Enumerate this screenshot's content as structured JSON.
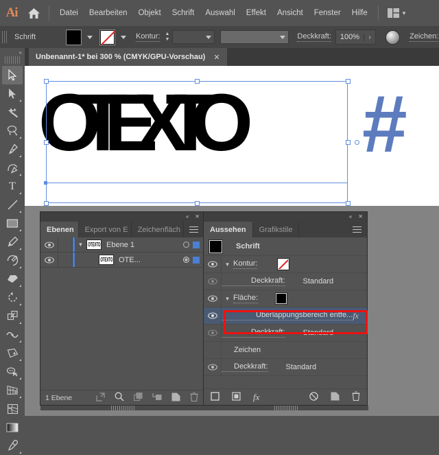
{
  "app": {
    "logo": "Ai",
    "home_icon": "home-icon"
  },
  "menu": {
    "items": [
      {
        "label": "Datei"
      },
      {
        "label": "Bearbeiten"
      },
      {
        "label": "Objekt"
      },
      {
        "label": "Schrift"
      },
      {
        "label": "Auswahl"
      },
      {
        "label": "Effekt"
      },
      {
        "label": "Ansicht"
      },
      {
        "label": "Fenster"
      },
      {
        "label": "Hilfe"
      }
    ],
    "workspace_icon": "workspace-switcher-icon",
    "workspace_chevron": "ⱟ"
  },
  "control_bar": {
    "context_label": "Schrift",
    "fill_swatch": "fill-swatch-black",
    "stroke_swatch": "stroke-swatch-none",
    "stroke_label": "Kontur:",
    "stroke_weight_value": "",
    "stroke_profile_value": "",
    "opacity_label": "Deckkraft:",
    "opacity_value": "100%",
    "opacity_arrow": "›",
    "recolor_icon": "recolor-artwork-icon",
    "character_label": "Zeichen:"
  },
  "document_tab": {
    "title": "Unbenannt-1* bei 300 % (CMYK/GPU-Vorschau)",
    "close_icon": "✕"
  },
  "toolbar": {
    "tools": [
      {
        "name": "selection-tool",
        "active": true
      },
      {
        "name": "direct-selection-tool",
        "active": false
      },
      {
        "name": "magic-wand-tool",
        "active": false
      },
      {
        "name": "lasso-tool",
        "active": false
      },
      {
        "name": "pen-tool",
        "active": false
      },
      {
        "name": "curvature-tool",
        "active": false
      },
      {
        "name": "type-tool",
        "active": false
      },
      {
        "name": "line-segment-tool",
        "active": false
      },
      {
        "name": "rectangle-tool",
        "active": false
      },
      {
        "name": "paintbrush-tool",
        "active": false
      },
      {
        "name": "shaper-tool",
        "active": false
      },
      {
        "name": "eraser-tool",
        "active": false
      },
      {
        "name": "rotate-tool",
        "active": false
      },
      {
        "name": "scale-tool",
        "active": false
      },
      {
        "name": "width-tool",
        "active": false
      },
      {
        "name": "free-transform-tool",
        "active": false
      },
      {
        "name": "shape-builder-tool",
        "active": false
      },
      {
        "name": "perspective-grid-tool",
        "active": false
      },
      {
        "name": "mesh-tool",
        "active": false
      },
      {
        "name": "gradient-tool",
        "active": false
      },
      {
        "name": "eyedropper-tool",
        "active": false
      }
    ]
  },
  "canvas": {
    "artwork_text": "OTEXTO",
    "artwork_hash": "#",
    "artwork_color": "#000000",
    "hash_color": "#5d7cbe",
    "selection_color": "#5f8ddf"
  },
  "layers_panel": {
    "tabs": [
      {
        "label": "Ebenen",
        "active": true
      },
      {
        "label": "Export von E",
        "active": false
      },
      {
        "label": "Zeichenfläch",
        "active": false
      }
    ],
    "menu_icon": "panel-menu-icon",
    "collapse_icon": "«",
    "close_icon": "✕",
    "rows": [
      {
        "name": "Ebene 1",
        "thumb": "OTEXTO",
        "indent": 0,
        "expanded": true,
        "target": "ring",
        "color": "#4a7fd4"
      },
      {
        "name": "OTE...",
        "thumb": "OTEXTO",
        "indent": 1,
        "expanded": false,
        "target": "double-ring",
        "color": "#4a7fd4"
      }
    ],
    "footer_label": "1 Ebene",
    "footer_icons": [
      {
        "name": "release-to-layers-icon"
      },
      {
        "name": "locate-object-icon"
      },
      {
        "name": "make-clipping-mask-icon"
      },
      {
        "name": "create-sublayer-icon"
      },
      {
        "name": "create-new-layer-icon"
      },
      {
        "name": "delete-selection-icon"
      }
    ]
  },
  "appearance_panel": {
    "tabs": [
      {
        "label": "Aussehen",
        "active": true
      },
      {
        "label": "Grafikstile",
        "active": false
      }
    ],
    "menu_icon": "panel-menu-icon",
    "collapse_icon": "«",
    "close_icon": "✕",
    "rows": [
      {
        "label": "Schrift",
        "type": "header",
        "swatch": "black",
        "eye": false,
        "chevron": false,
        "indent": 0
      },
      {
        "label": "Kontur:",
        "type": "stroke",
        "swatch": "none",
        "eye": true,
        "chevron": true,
        "indent": 0
      },
      {
        "label": "Deckkraft:",
        "value": "Standard",
        "type": "opacity",
        "eye": true,
        "dim": true,
        "indent": 1
      },
      {
        "label": "Fläche:",
        "type": "fill",
        "swatch": "black",
        "eye": true,
        "chevron": true,
        "indent": 0
      },
      {
        "label": "Überlappungsbereich entfe...",
        "type": "effect",
        "fx": "fx",
        "eye": true,
        "selected": true,
        "indent": 1
      },
      {
        "label": "Deckkraft:",
        "value": "Standard",
        "type": "opacity",
        "eye": true,
        "dim": true,
        "indent": 1
      },
      {
        "label": "Zeichen",
        "type": "plain",
        "eye": false,
        "indent": 1
      },
      {
        "label": "Deckkraft:",
        "value": "Standard",
        "type": "opacity",
        "eye": true,
        "indent": 1
      }
    ],
    "footer_icons": [
      {
        "name": "add-new-stroke-icon"
      },
      {
        "name": "add-new-fill-icon"
      },
      {
        "name": "add-new-effect-icon"
      },
      {
        "name": "clear-appearance-icon"
      },
      {
        "name": "duplicate-selected-item-icon"
      },
      {
        "name": "delete-selected-item-icon"
      }
    ],
    "annotation_color": "#ee1111"
  }
}
